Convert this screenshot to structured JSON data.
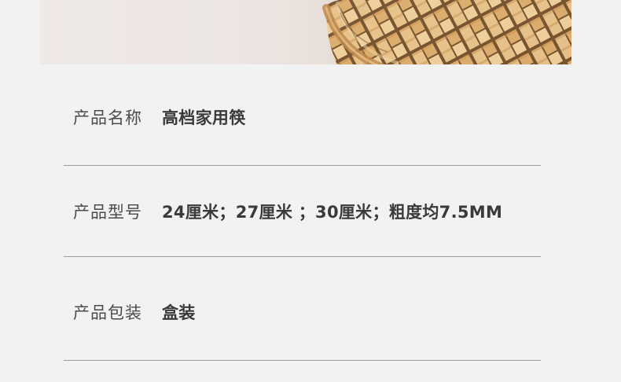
{
  "hero": {
    "image": "bamboo-basket-photo"
  },
  "specs": [
    {
      "label": "产品名称",
      "value": "高档家用筷"
    },
    {
      "label": "产品型号",
      "value": "24厘米；27厘米 ；30厘米；粗度均7.5MM"
    },
    {
      "label": "产品包装",
      "value": "盒装"
    }
  ]
}
